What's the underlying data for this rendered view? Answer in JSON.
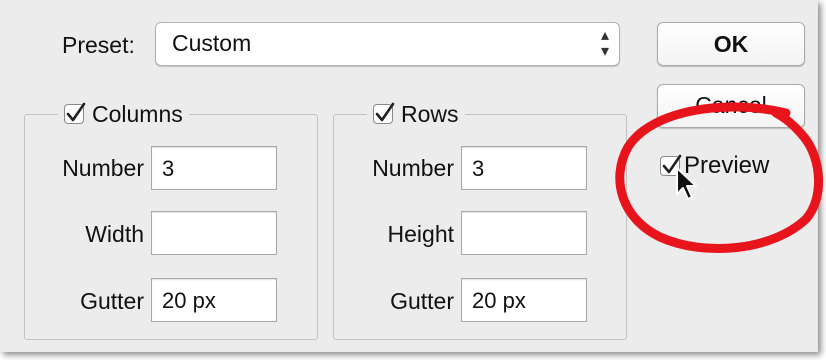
{
  "preset": {
    "label": "Preset:",
    "value": "Custom",
    "arrows_icon": "up-down-arrows-icon"
  },
  "buttons": {
    "ok_label": "OK",
    "cancel_label": "Cancel"
  },
  "preview": {
    "label": "Preview",
    "checked": true,
    "highlight_color": "#e8141c"
  },
  "columns": {
    "title": "Columns",
    "checked": true,
    "number_label": "Number",
    "number_value": "3",
    "width_label": "Width",
    "width_value": "",
    "gutter_label": "Gutter",
    "gutter_value": "20 px"
  },
  "rows": {
    "title": "Rows",
    "checked": true,
    "number_label": "Number",
    "number_value": "3",
    "height_label": "Height",
    "height_value": "",
    "gutter_label": "Gutter",
    "gutter_value": "20 px"
  }
}
